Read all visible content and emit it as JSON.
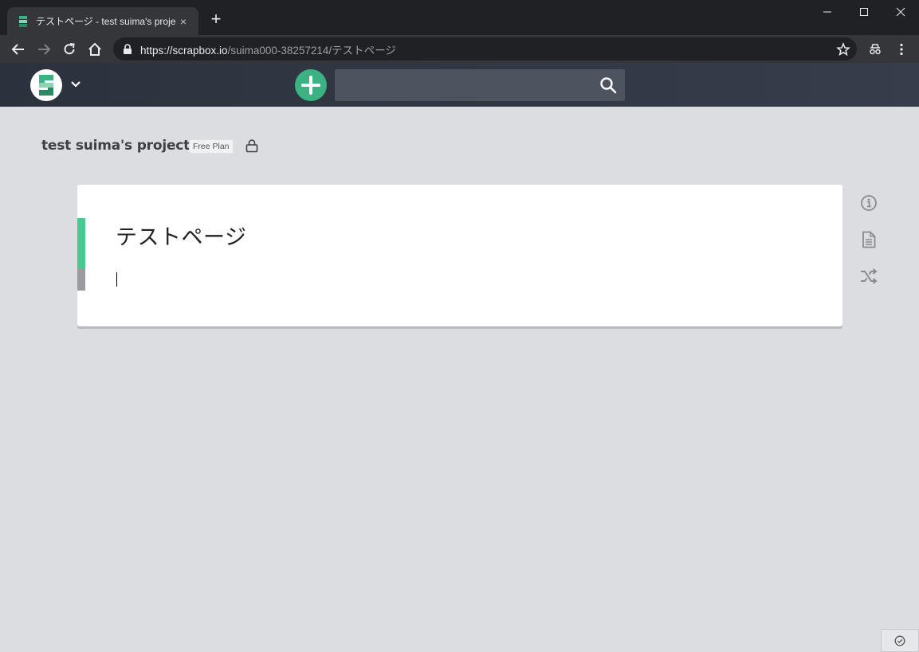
{
  "browser": {
    "tab_title": "テストページ - test suima's project",
    "tab_close": "×",
    "new_tab": "+",
    "url_host": "https://scrapbox.io",
    "url_path": "/suima000-38257214/テストページ"
  },
  "app": {
    "search_placeholder": "",
    "project_title": "test suima's project",
    "plan_badge": "Free Plan",
    "page_title": "テストページ"
  },
  "colors": {
    "accent_green": "#3cb283",
    "title_bar": "#4bc78f",
    "line_bar": "#9a9b9e"
  }
}
